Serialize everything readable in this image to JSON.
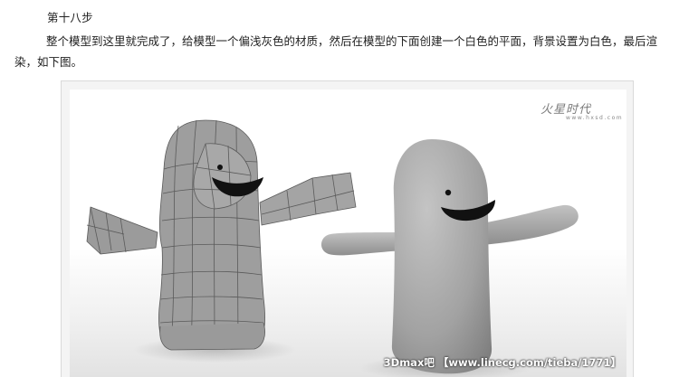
{
  "article": {
    "step_title": "第十八步",
    "paragraph": "整个模型到这里就完成了，给模型一个偏浅灰色的材质，然后在模型的下面创建一个白色的平面，背景设置为白色，最后渲染，如下图。"
  },
  "figure": {
    "watermark_logo": "火星时代",
    "watermark_logo_sub": "www.hxsd.com",
    "credit_text": "3Dmax吧 【www.linecg.com/tieba/1771】"
  },
  "colors": {
    "wire_body": "#9a9a9a",
    "wire_lines": "#555555",
    "smooth_body": "#a3a3a3",
    "background": "#ffffff"
  }
}
